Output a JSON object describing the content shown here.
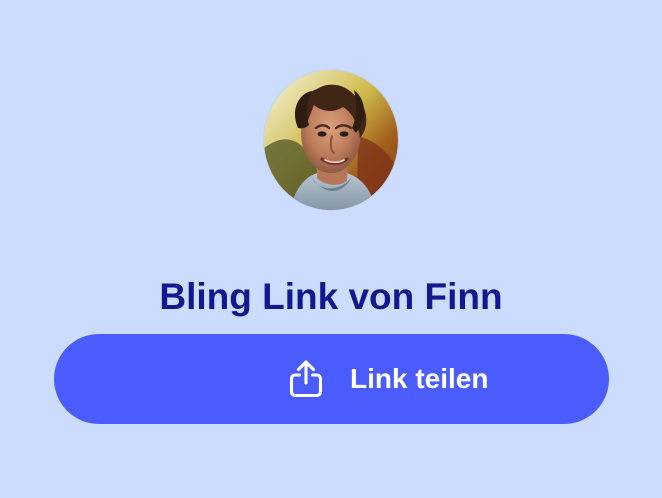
{
  "profile": {
    "avatar_alt": "Profilbild von Finn",
    "title": "Bling Link von Finn"
  },
  "share": {
    "label": "Link teilen",
    "icon": "share-icon"
  },
  "colors": {
    "background": "#cbdcff",
    "title": "#12188d",
    "button": "#4b5cff",
    "button_text": "#ffffff"
  }
}
